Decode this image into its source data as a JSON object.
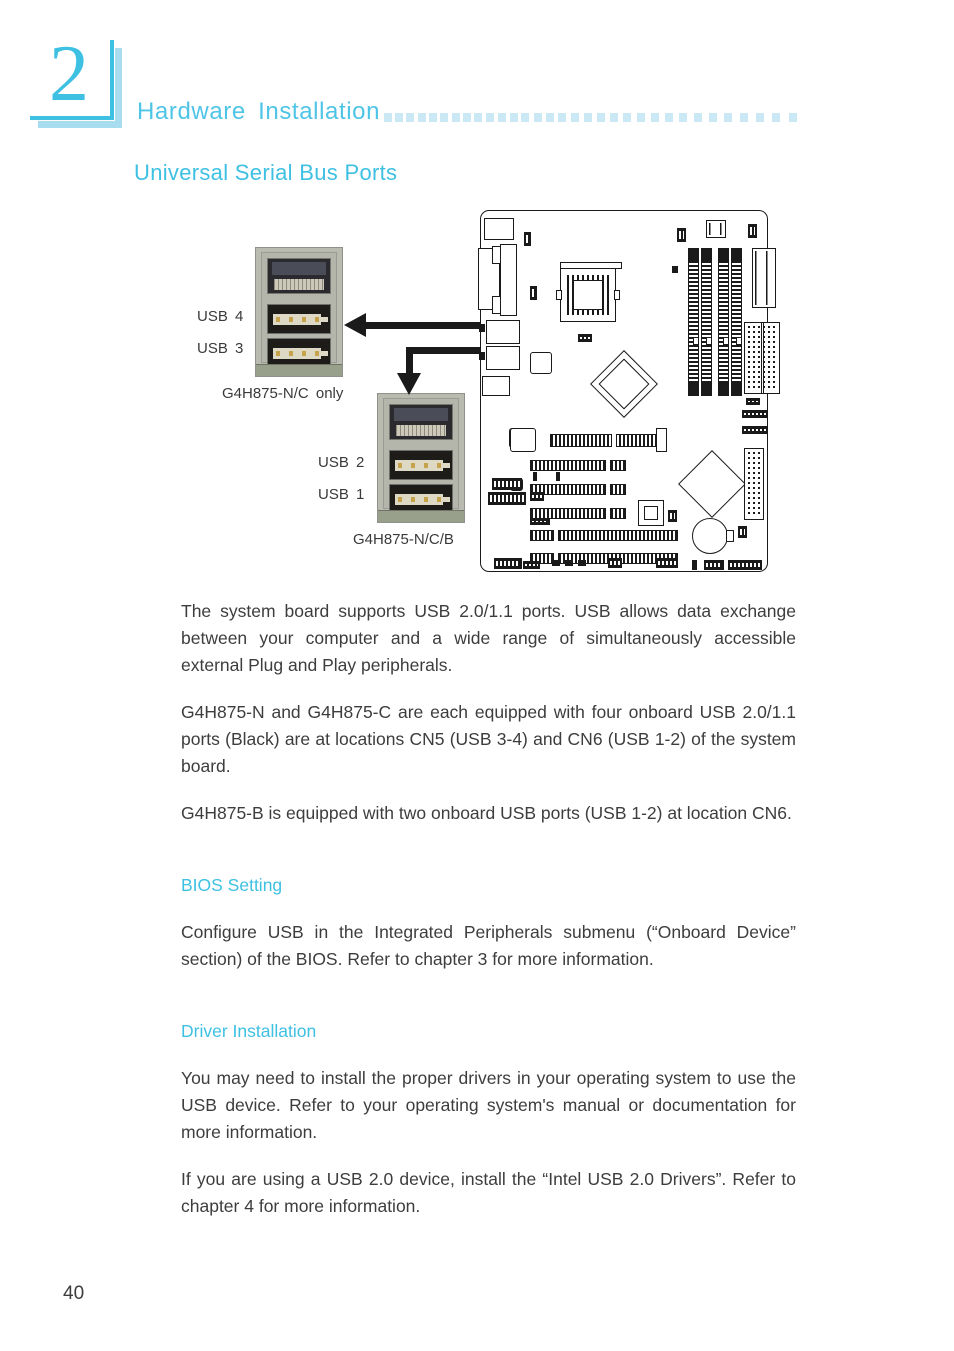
{
  "header": {
    "chapter_number": "2",
    "chapter_title": "Hardware  Installation",
    "dot_count": 36
  },
  "section": {
    "title": "Universal Serial Bus Ports"
  },
  "figure": {
    "usb_top": {
      "labels": [
        "USB  4",
        "USB  3"
      ],
      "caption": "G4H875-N/C  only"
    },
    "usb_bottom": {
      "labels": [
        "USB  2",
        "USB  1"
      ],
      "caption": "G4H875-N/C/B"
    }
  },
  "body": {
    "paragraph_1": "The system board supports USB 2.0/1.1 ports. USB allows data exchange between your computer and a wide range of simultaneously accessible external Plug and Play peripherals.",
    "paragraph_2": "G4H875-N and G4H875-C are each equipped with four onboard USB 2.0/1.1 ports (Black) are at locations CN5 (USB 3-4) and CN6 (USB 1-2) of the system board.",
    "paragraph_3": "G4H875-B is equipped with two onboard USB ports (USB 1-2) at location CN6.",
    "bios_heading": "BIOS Setting",
    "paragraph_4": "Configure USB in the Integrated Peripherals submenu (“Onboard Device” section) of the BIOS. Refer to chapter 3 for more information.",
    "driver_heading": "Driver Installation",
    "paragraph_5": "You may need to install the proper drivers in your operating system to use the USB device. Refer to your operating system's manual or documentation for more information.",
    "paragraph_6": "If you are using a USB 2.0 device, install the “Intel USB 2.0 Drivers”. Refer to chapter 4 for more information."
  },
  "footer": {
    "page_number": "40"
  },
  "colors": {
    "accent_cyan": "#3ec0e3",
    "header_cyan": "#4ec4e6",
    "dot_blue": "#cbe9f4",
    "badge_shadow": "#a8dcef",
    "body_text": "#3d3d3d",
    "diagram_line": "#1a1a1a"
  }
}
